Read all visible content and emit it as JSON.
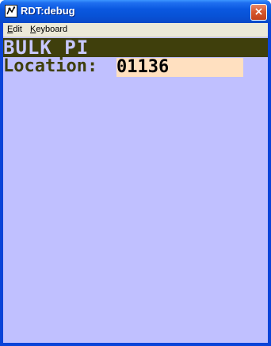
{
  "window": {
    "title": "RDT:debug",
    "close_label": "×"
  },
  "menu": {
    "items": [
      {
        "label_underlined": "E",
        "label_rest": "dit"
      },
      {
        "label_underlined": "K",
        "label_rest": "eyboard"
      }
    ]
  },
  "screen": {
    "header": "BULK PI",
    "location_label": "Location:",
    "location_value": "01136"
  },
  "colors": {
    "client_bg": "#c0c0ff",
    "header_bg": "#3f3f0c",
    "input_bg": "#ffe0c0"
  }
}
